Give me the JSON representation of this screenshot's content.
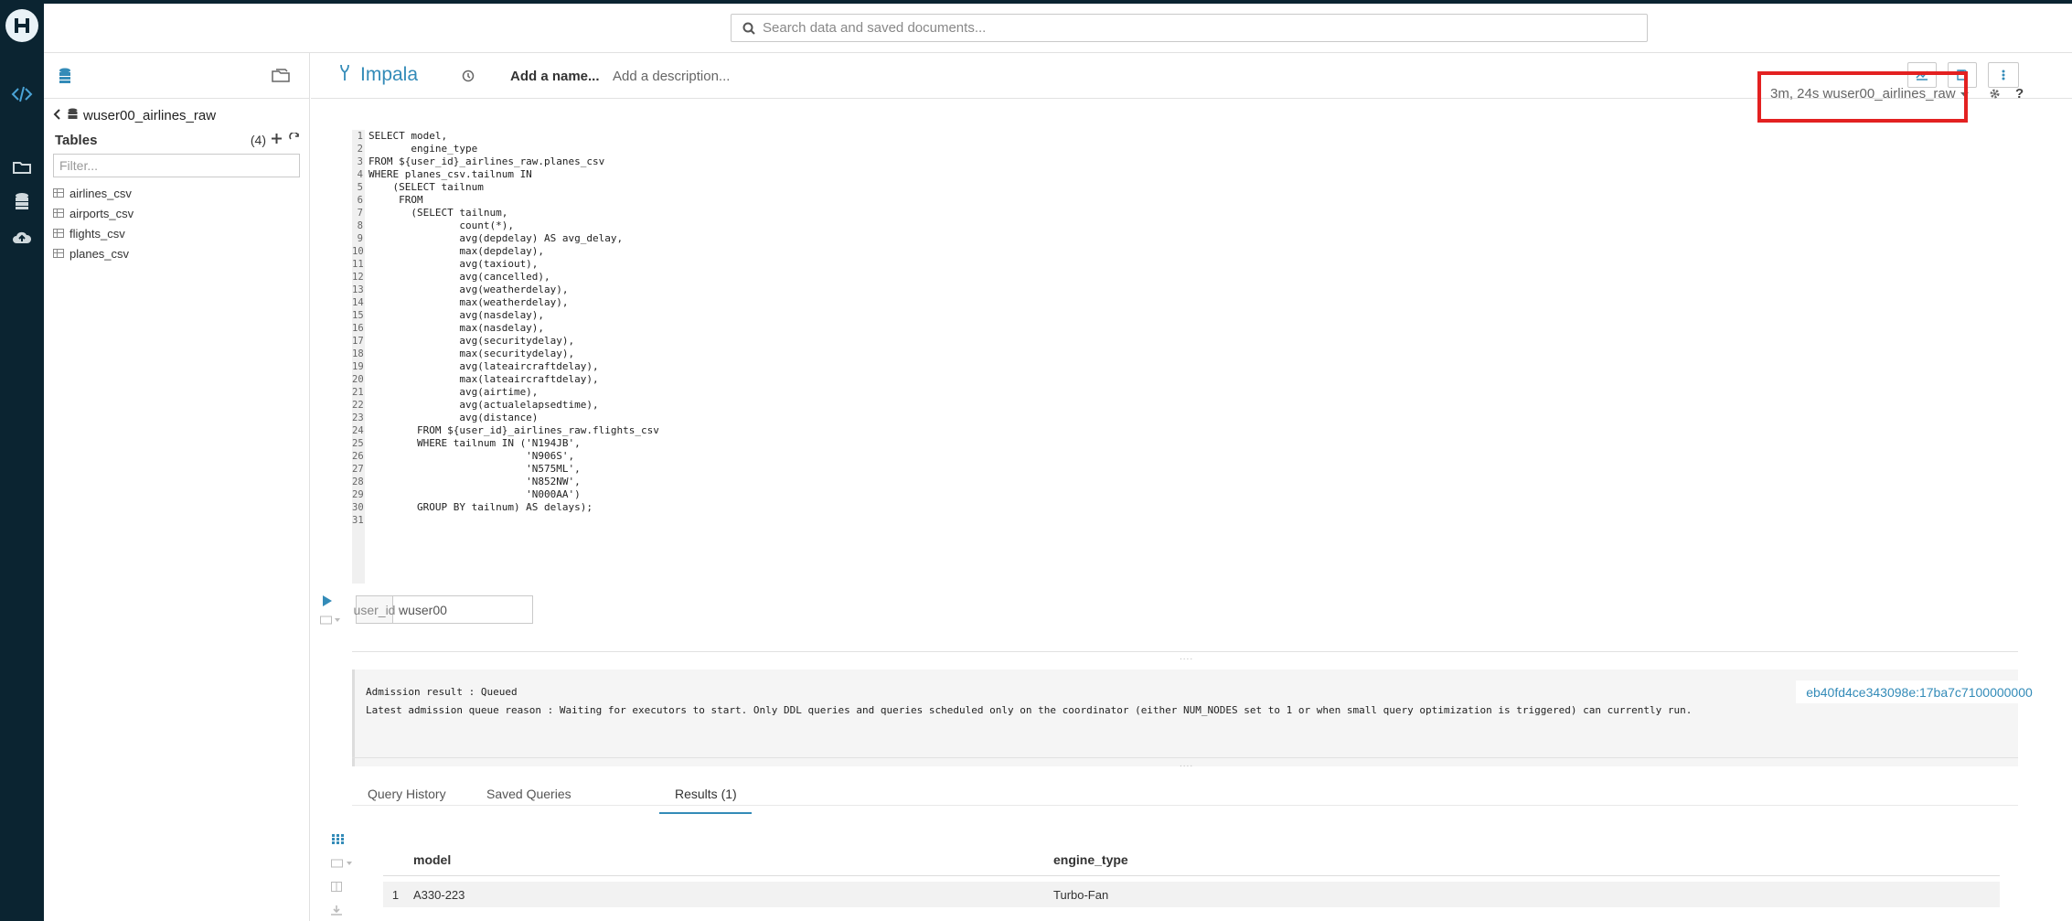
{
  "app": {
    "search_placeholder": "Search data and saved documents...",
    "colors": {
      "accent": "#338bb8",
      "rail": "#0b2431",
      "highlight": "#e32121"
    }
  },
  "assist": {
    "database": "wuser00_airlines_raw",
    "tables_label": "Tables",
    "tables_count": "(4)",
    "filter_placeholder": "Filter...",
    "tables": [
      "airlines_csv",
      "airports_csv",
      "flights_csv",
      "planes_csv"
    ]
  },
  "editor": {
    "engine": "Impala",
    "add_name": "Add a name...",
    "add_description": "Add a description...",
    "session": "3m, 24s wuser00_airlines_raw",
    "help": "?",
    "code_lines": [
      "SELECT model,",
      "       engine_type",
      "FROM ${user_id}_airlines_raw.planes_csv",
      "WHERE planes_csv.tailnum IN",
      "    (SELECT tailnum",
      "     FROM",
      "       (SELECT tailnum,",
      "               count(*),",
      "               avg(depdelay) AS avg_delay,",
      "               max(depdelay),",
      "               avg(taxiout),",
      "               avg(cancelled),",
      "               avg(weatherdelay),",
      "               max(weatherdelay),",
      "               avg(nasdelay),",
      "               max(nasdelay),",
      "               avg(securitydelay),",
      "               max(securitydelay),",
      "               avg(lateaircraftdelay),",
      "               max(lateaircraftdelay),",
      "               avg(airtime),",
      "               avg(actualelapsedtime),",
      "               avg(distance)",
      "        FROM ${user_id}_airlines_raw.flights_csv",
      "        WHERE tailnum IN ('N194JB',",
      "                          'N906S',",
      "                          'N575ML',",
      "                          'N852NW',",
      "                          'N000AA')",
      "        GROUP BY tailnum) AS delays);",
      ""
    ],
    "param_key": "user_id",
    "param_value": "wuser00"
  },
  "log": {
    "line1": "Admission result : Queued",
    "line2": "Latest admission queue reason : Waiting for executors to start. Only DDL queries and queries scheduled only on the coordinator (either NUM_NODES set to 1 or when small query optimization is triggered) can currently run.",
    "query_id": "eb40fd4ce343098e:17ba7c7100000000"
  },
  "tabs": [
    "Query History",
    "Saved Queries",
    "Results (1)"
  ],
  "results": {
    "columns": [
      "model",
      "engine_type"
    ],
    "rows": [
      {
        "idx": "1",
        "model": "A330-223",
        "engine_type": "Turbo-Fan"
      }
    ]
  }
}
